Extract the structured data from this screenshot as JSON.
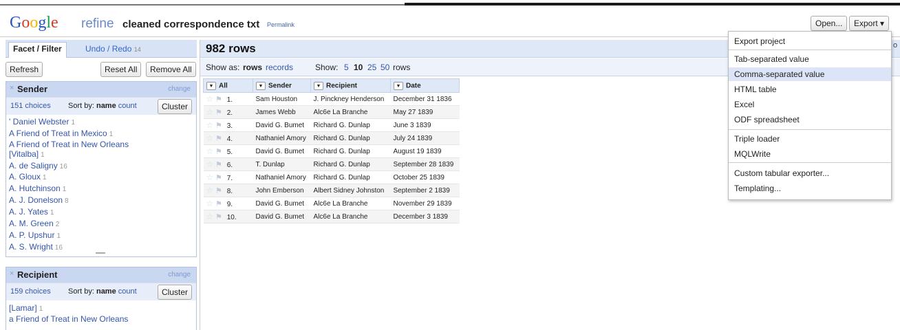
{
  "app": {
    "logo_letters": [
      "G",
      "o",
      "o",
      "g",
      "l",
      "e"
    ],
    "refine_word": "refine",
    "project_name": "cleaned correspondence txt",
    "permalink": "Permalink"
  },
  "header": {
    "open_label": "Open...",
    "export_label": "Export ▾"
  },
  "left": {
    "tab_facet": "Facet / Filter",
    "tab_undo": "Undo / Redo",
    "undo_count": "14",
    "refresh_label": "Refresh",
    "reset_label": "Reset All",
    "remove_label": "Remove All",
    "facets": [
      {
        "x": "×",
        "title": "Sender",
        "change": "change",
        "choices": "151 choices",
        "sortby": "Sort by:",
        "sort_name": "name",
        "sort_count": "count",
        "cluster": "Cluster",
        "items": [
          {
            "label": "' Daniel Webster",
            "count": "1"
          },
          {
            "label": "A Friend of Treat in Mexico",
            "count": "1"
          },
          {
            "label": "A Friend of Treat in New Orleans",
            "count": ""
          },
          {
            "label": "[Vitalba]",
            "count": "1"
          },
          {
            "label": "A. de Saligny",
            "count": "16"
          },
          {
            "label": "A. Gloux",
            "count": "1"
          },
          {
            "label": "A. Hutchinson",
            "count": "1"
          },
          {
            "label": "A. J. Donelson",
            "count": "8"
          },
          {
            "label": "A. J. Yates",
            "count": "1"
          },
          {
            "label": "A. M. Green",
            "count": "2"
          },
          {
            "label": "A. P. Upshur",
            "count": "1"
          },
          {
            "label": "A. S. Wright",
            "count": "16"
          }
        ]
      },
      {
        "x": "×",
        "title": "Recipient",
        "change": "change",
        "choices": "159 choices",
        "sortby": "Sort by:",
        "sort_name": "name",
        "sort_count": "count",
        "cluster": "Cluster",
        "items": [
          {
            "label": "[Lamar]",
            "count": "1"
          },
          {
            "label": "a Friend of Treat in New Orleans",
            "count": ""
          }
        ]
      }
    ]
  },
  "grid": {
    "row_count": "982 rows",
    "show_as": "Show as:",
    "rows_mode": "rows",
    "records_mode": "records",
    "show": "Show:",
    "page_sizes": [
      "5",
      "10",
      "25",
      "50"
    ],
    "rows_suffix": "rows",
    "columns": [
      "All",
      "Sender",
      "Recipient",
      "Date"
    ],
    "rows": [
      {
        "n": "1.",
        "sender": "Sam Houston",
        "recipient": "J. Pinckney Henderson",
        "date": "December 31 1836"
      },
      {
        "n": "2.",
        "sender": "James Webb",
        "recipient": "Alc6e La Branche",
        "date": "May 27 1839"
      },
      {
        "n": "3.",
        "sender": "David G. Bumet",
        "recipient": "Richard G. Dunlap",
        "date": "June 3 1839"
      },
      {
        "n": "4.",
        "sender": "Nathaniel Amory",
        "recipient": "Richard G. Dunlap",
        "date": "July 24 1839"
      },
      {
        "n": "5.",
        "sender": "David G. Bumet",
        "recipient": "Richard G. Dunlap",
        "date": "August 19 1839"
      },
      {
        "n": "6.",
        "sender": "T. Dunlap",
        "recipient": "Richard G. Dunlap",
        "date": "September 28 1839"
      },
      {
        "n": "7.",
        "sender": "Nathaniel Amory",
        "recipient": "Richard G. Dunlap",
        "date": "October 25 1839"
      },
      {
        "n": "8.",
        "sender": "John Emberson",
        "recipient": "Albert Sidney Johnston",
        "date": "September 2 1839"
      },
      {
        "n": "9.",
        "sender": "David G. Bumet",
        "recipient": "Alc6e La Branche",
        "date": "November 29 1839"
      },
      {
        "n": "10.",
        "sender": "David G. Bumet",
        "recipient": "Alc6e La Branche",
        "date": "December 3 1839"
      }
    ]
  },
  "export_menu": {
    "items": [
      {
        "label": "Export project",
        "highlight": false
      },
      {
        "label": "Tab-separated value",
        "highlight": false
      },
      {
        "label": "Comma-separated value",
        "highlight": true
      },
      {
        "label": "HTML table",
        "highlight": false
      },
      {
        "label": "Excel",
        "highlight": false
      },
      {
        "label": "ODF spreadsheet",
        "highlight": false
      },
      {
        "label": "Triple loader",
        "highlight": false
      },
      {
        "label": "MQLWrite",
        "highlight": false
      },
      {
        "label": "Custom tabular exporter...",
        "highlight": false
      },
      {
        "label": "Templating...",
        "highlight": false
      }
    ]
  },
  "icons": {
    "star": "star-icon",
    "flag": "flag-icon",
    "dropdown": "dropdown-arrow-icon",
    "close": "close-icon"
  }
}
